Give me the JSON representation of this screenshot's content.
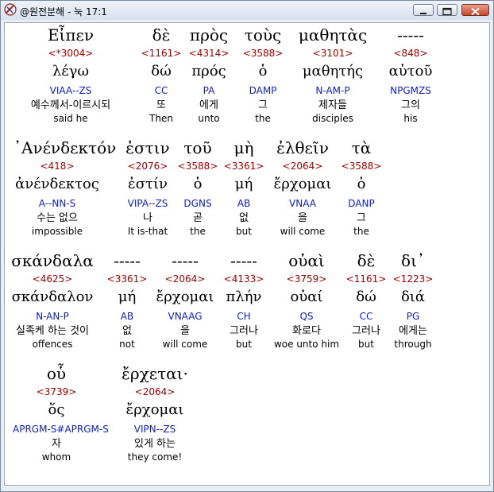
{
  "window": {
    "title": "@원전분해 - 눅 17:1",
    "minimize_label": "",
    "maximize_label": "",
    "close_label": ""
  },
  "colors": {
    "strong": "#a00000",
    "parse": "#1020c0",
    "text": "#000000"
  },
  "icons": {
    "app": "app-logo-icon",
    "minimize": "minimize-icon",
    "maximize": "maximize-icon",
    "close": "close-icon"
  },
  "rows": [
    {
      "words": [
        {
          "greek": "Εἶπεν",
          "strong": "<*3004>",
          "lemma": "λέγω",
          "parse": "VIAA--ZS",
          "korean": "예수께서-이르시되",
          "english": "said he"
        },
        {
          "greek": "δὲ",
          "strong": "<1161>",
          "lemma": "δώ",
          "parse": "CC",
          "korean": "또",
          "english": "Then"
        },
        {
          "greek": "πρὸς",
          "strong": "<4314>",
          "lemma": "πρός",
          "parse": "PA",
          "korean": "에게",
          "english": "unto"
        },
        {
          "greek": "τοὺς",
          "strong": "<3588>",
          "lemma": "ὁ",
          "parse": "DAMP",
          "korean": "그",
          "english": "the"
        },
        {
          "greek": "μαθητὰς",
          "strong": "<3101>",
          "lemma": "μαθητής",
          "parse": "N-AM-P",
          "korean": "제자들",
          "english": "disciples"
        },
        {
          "greek": "-----",
          "strong": "<848>",
          "lemma": "αὑτοῦ",
          "parse": "NPGMZS",
          "korean": "그의",
          "english": "his"
        }
      ]
    },
    {
      "words": [
        {
          "greek": "᾿Ανένδεκτόν",
          "strong": "<418>",
          "lemma": "ἀνένδεκτος",
          "parse": "A--NN-S",
          "korean": "수는 없으",
          "english": "impossible"
        },
        {
          "greek": "ἐστιν",
          "strong": "<2076>",
          "lemma": "ἐστίν",
          "parse": "VIPA--ZS",
          "korean": "나",
          "english": "It is-that"
        },
        {
          "greek": "τοῦ",
          "strong": "<3588>",
          "lemma": "ὁ",
          "parse": "DGNS",
          "korean": "곧",
          "english": "the"
        },
        {
          "greek": "μὴ",
          "strong": "<3361>",
          "lemma": "μή",
          "parse": "AB",
          "korean": "없",
          "english": "but"
        },
        {
          "greek": "ἐλθεῖν",
          "strong": "<2064>",
          "lemma": "ἔρχομαι",
          "parse": "VNAA",
          "korean": "을",
          "english": "will come"
        },
        {
          "greek": "τὰ",
          "strong": "<3588>",
          "lemma": "ὁ",
          "parse": "DANP",
          "korean": "그",
          "english": "the"
        }
      ]
    },
    {
      "words": [
        {
          "greek": "σκάνδαλα",
          "strong": "<4625>",
          "lemma": "σκάνδαλον",
          "parse": "N-AN-P",
          "korean": "실족케 하는 것이",
          "english": "offences"
        },
        {
          "greek": "-----",
          "strong": "<3361>",
          "lemma": "μή",
          "parse": "AB",
          "korean": "없",
          "english": "not"
        },
        {
          "greek": "-----",
          "strong": "<2064>",
          "lemma": "ἔρχομαι",
          "parse": "VNAAG",
          "korean": "을",
          "english": "will come"
        },
        {
          "greek": "-----",
          "strong": "<4133>",
          "lemma": "πλήν",
          "parse": "CH",
          "korean": "그러나",
          "english": "but"
        },
        {
          "greek": "οὐαὶ",
          "strong": "<3759>",
          "lemma": "οὐαί",
          "parse": "QS",
          "korean": "화로다",
          "english": "woe unto him"
        },
        {
          "greek": "δὲ",
          "strong": "<1161>",
          "lemma": "δώ",
          "parse": "CC",
          "korean": "그러나",
          "english": "but"
        },
        {
          "greek": "δι᾽",
          "strong": "<1223>",
          "lemma": "διά",
          "parse": "PG",
          "korean": "에게는",
          "english": "through"
        }
      ]
    },
    {
      "words": [
        {
          "greek": "οὗ",
          "strong": "<3739>",
          "lemma": "ὅς",
          "parse": "APRGM-S#APRGM-S",
          "korean": "자",
          "english": "whom"
        },
        {
          "greek": "ἔρχεται·",
          "strong": "<2064>",
          "lemma": "ἔρχομαι",
          "parse": "VIPN--ZS",
          "korean": "있게 하는",
          "english": "they come!"
        }
      ]
    }
  ]
}
